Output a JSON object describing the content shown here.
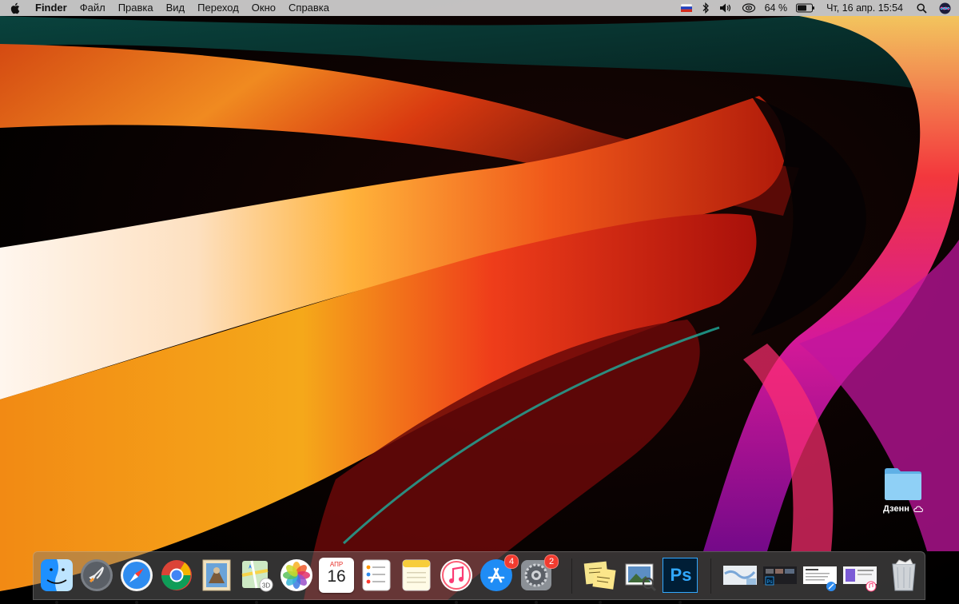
{
  "menubar": {
    "app_name": "Finder",
    "items": [
      "Файл",
      "Правка",
      "Вид",
      "Переход",
      "Окно",
      "Справка"
    ],
    "status": {
      "battery_percent": "64 %",
      "datetime": "Чт, 16 апр.  15:54"
    },
    "icons": [
      "apple-icon",
      "flag-ru-icon",
      "bluetooth-icon",
      "volume-icon",
      "airplay-icon",
      "battery-icon",
      "search-icon",
      "siri-icon"
    ]
  },
  "desktop": {
    "folder_label": "Дзенн"
  },
  "dock": {
    "apps": [
      {
        "name": "finder",
        "running": true
      },
      {
        "name": "launchpad",
        "running": false
      },
      {
        "name": "safari",
        "running": true
      },
      {
        "name": "chrome",
        "running": false
      },
      {
        "name": "mail",
        "running": false
      },
      {
        "name": "maps",
        "running": true
      },
      {
        "name": "photos",
        "running": false
      },
      {
        "name": "calendar",
        "running": false
      },
      {
        "name": "reminders",
        "running": false
      },
      {
        "name": "notes",
        "running": false
      },
      {
        "name": "itunes",
        "running": true
      },
      {
        "name": "app-store",
        "running": false,
        "badge": "4"
      },
      {
        "name": "system-preferences",
        "running": true,
        "badge": "2"
      },
      {
        "name": "stickies",
        "running": true
      },
      {
        "name": "preview",
        "running": false
      },
      {
        "name": "photoshop",
        "running": true
      },
      {
        "name": "minimized-window-1",
        "running": false
      },
      {
        "name": "minimized-window-2",
        "running": false
      },
      {
        "name": "minimized-window-3",
        "running": false
      },
      {
        "name": "minimized-window-4",
        "running": false
      },
      {
        "name": "trash",
        "running": false
      }
    ],
    "calendar": {
      "month": "АПР",
      "day": "16"
    },
    "photoshop_label": "Ps"
  },
  "colors": {
    "menubar_bg": "#ebebeb",
    "badge_red": "#f23b2f",
    "folder_blue": "#7cc4f2"
  }
}
